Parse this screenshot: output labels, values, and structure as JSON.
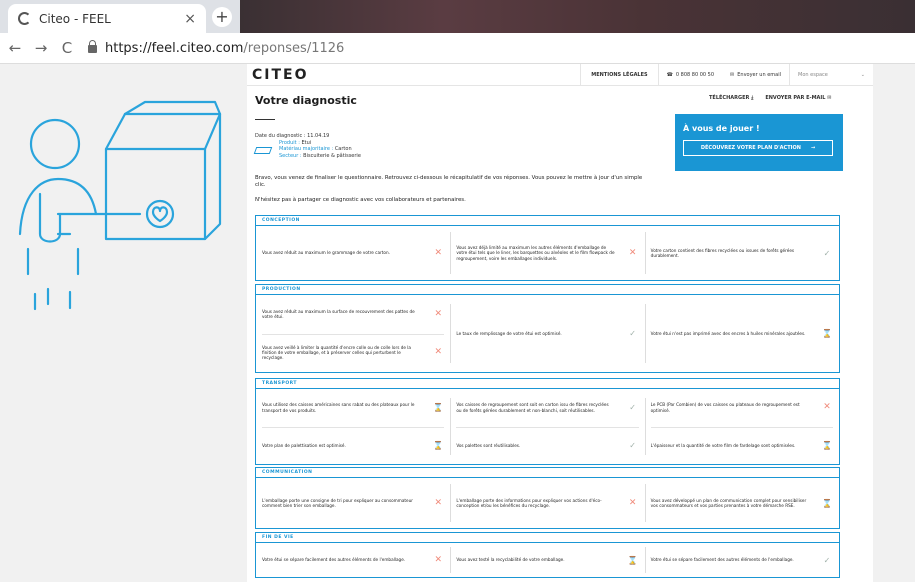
{
  "browser": {
    "tab_title": "Citeo - FEEL",
    "close_glyph": "×",
    "newtab_glyph": "+",
    "back_glyph": "←",
    "forward_glyph": "→",
    "reload_glyph": "C",
    "url_host": "https://feel.citeo.com",
    "url_path": "/reponses/1126"
  },
  "header": {
    "logo": "CITEO",
    "mentions": "MENTIONS LÉGALES",
    "phone": "0 808 80 00 50",
    "mail": "Envoyer un email",
    "space": "Mon espace",
    "space_arrow": "⌄"
  },
  "page": {
    "title": "Votre diagnostic",
    "download": "TÉLÉCHARGER ⤓",
    "send_mail": "ENVOYER PAR E-MAIL ✉",
    "date_label": "Date du diagnostic : 11.04.19",
    "product_label": "Produit :",
    "product_value": "Etui",
    "material_label": "Matériau majoritaire :",
    "material_value": "Carton",
    "sector_label": "Secteur :",
    "sector_value": "Biscuiterie & pâtisserie",
    "intro": "Bravo, vous venez de finaliser le questionnaire. Retrouvez ci-dessous le récapitulatif de vos réponses. Vous pouvez le mettre à jour d'un simple clic.",
    "intro2": "N'hésitez pas à partager ce diagnostic avec vos collaborateurs et partenaires."
  },
  "cta": {
    "heading": "À vous de jouer !",
    "button": "DÉCOUVREZ VOTRE PLAN D'ACTION",
    "arrow": "→"
  },
  "marks": {
    "x": "✕",
    "check": "✓",
    "na": "⌛"
  },
  "sections": [
    {
      "title": "CONCEPTION",
      "columns": [
        [
          {
            "text": "Vous avez réduit au maximum le grammage de votre carton.",
            "mark": "x"
          }
        ],
        [
          {
            "text": "Vous avez déjà limité au maximum les autres éléments d'emballage de votre étui tels que le liner, les barquettes ou alvéoles et le film flowpack de regroupement, voire les emballages individuels.",
            "mark": "x"
          }
        ],
        [
          {
            "text": "Votre carton contient des fibres recyclées ou issues de forêts gérées durablement.",
            "mark": "check"
          }
        ]
      ]
    },
    {
      "title": "PRODUCTION",
      "columns": [
        [
          {
            "text": "Vous avez réduit au maximum la surface de recouvrement des pattes de votre étui.",
            "mark": "x"
          },
          {
            "text": "Vous avez veillé à limiter la quantité d'encre colle ou de colle lors de la finition de votre emballage, et à préserver celles qui perturbent le recyclage.",
            "mark": "x"
          }
        ],
        [
          {
            "text": "Le taux de remplissage de votre étui est optimisé.",
            "mark": "check"
          }
        ],
        [
          {
            "text": "Votre étui n'est pas imprimé avec des encres à huiles minérales ajoutées.",
            "mark": "na"
          }
        ]
      ]
    },
    {
      "title": "TRANSPORT",
      "columns": [
        [
          {
            "text": "Vous utilisez des caisses américaines sans rabat ou des plateaux pour le transport de vos produits.",
            "mark": "na"
          },
          {
            "text": "Votre plan de palettisation est optimisé.",
            "mark": "na"
          }
        ],
        [
          {
            "text": "Vos caisses de regroupement sont soit en carton issu de fibres recyclées ou de forêts gérées durablement et non-blanchi, soit réutilisables.",
            "mark": "check"
          },
          {
            "text": "Vos palettes sont réutilisables.",
            "mark": "check"
          }
        ],
        [
          {
            "text": "Le PCB (Par Combien) de vos caisses ou plateaux de regroupement est optimisé.",
            "mark": "x"
          },
          {
            "text": "L'épaisseur et la quantité de votre film de fardelage sont optimisées.",
            "mark": "na"
          }
        ]
      ]
    },
    {
      "title": "COMMUNICATION",
      "columns": [
        [
          {
            "text": "L'emballage porte une consigne de tri pour expliquer au consommateur comment bien trier son emballage.",
            "mark": "x"
          }
        ],
        [
          {
            "text": "L'emballage porte des informations pour expliquer vos actions d'éco-conception et/ou les bénéfices du recyclage.",
            "mark": "x"
          }
        ],
        [
          {
            "text": "Vous avez développé un plan de communication complet pour sensibiliser vos consommateurs et vos parties prenantes à votre démarche RSE.",
            "mark": "na"
          }
        ]
      ]
    },
    {
      "title": "FIN DE VIE",
      "columns": [
        [
          {
            "text": "Votre étui se sépare facilement des autres éléments de l'emballage.",
            "mark": "x"
          }
        ],
        [
          {
            "text": "Vous avez testé la recyclabilité de votre emballage.",
            "mark": "na"
          }
        ],
        [
          {
            "text": "Votre étui se sépare facilement des autres éléments de l'emballage.",
            "mark": "check"
          }
        ]
      ]
    }
  ]
}
